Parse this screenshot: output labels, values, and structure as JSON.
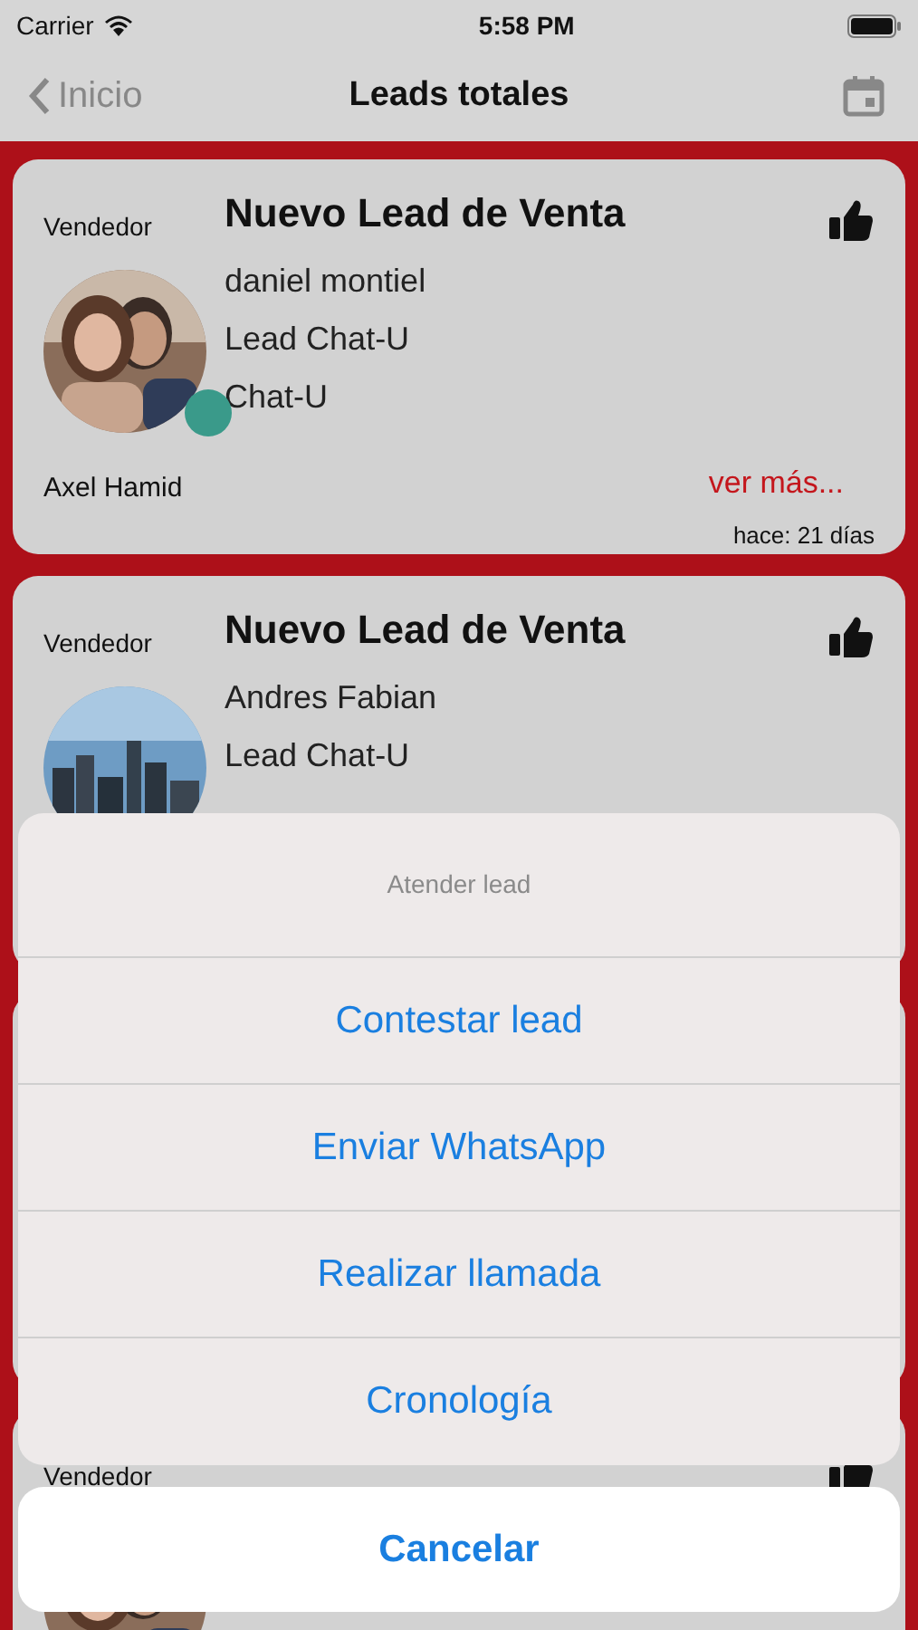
{
  "status_bar": {
    "carrier": "Carrier",
    "time": "5:58 PM"
  },
  "nav": {
    "back": "Inicio",
    "title": "Leads totales"
  },
  "cards": [
    {
      "seller_label": "Vendedor",
      "title": "Nuevo Lead de Venta",
      "lines": [
        "daniel montiel",
        "Lead Chat-U",
        "Chat-U"
      ],
      "seller_name": "Axel Hamid",
      "more": "ver más...",
      "age": "hace: 21 días",
      "online": true
    },
    {
      "seller_label": "Vendedor",
      "title": "Nuevo Lead de Venta",
      "lines": [
        "Andres Fabian",
        "Lead Chat-U"
      ]
    },
    {
      "seller_label": "Vendedor"
    }
  ],
  "action_sheet": {
    "title": "Atender lead",
    "actions": [
      "Contestar lead",
      "Enviar WhatsApp",
      "Realizar llamada",
      "Cronología"
    ],
    "cancel": "Cancelar"
  }
}
